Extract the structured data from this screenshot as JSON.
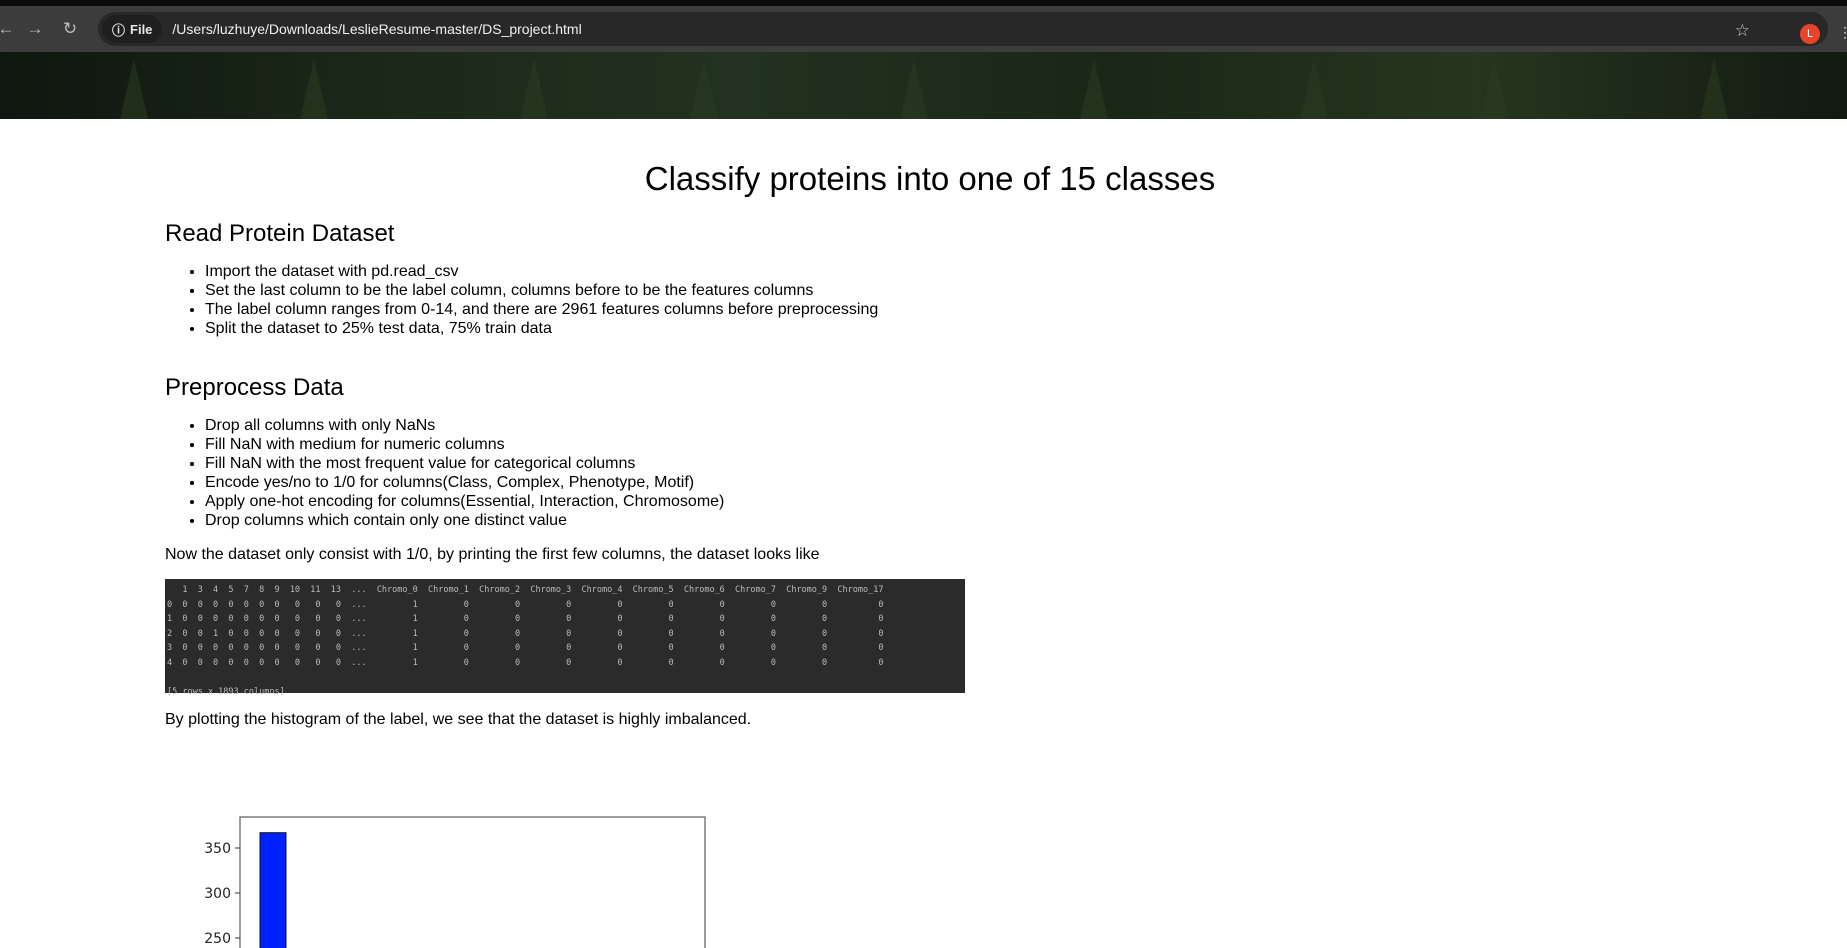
{
  "browser": {
    "chip_label": "File",
    "url": "/Users/luzhuye/Downloads/LeslieResume-master/DS_project.html",
    "avatar_letter": "L"
  },
  "page": {
    "title": "Classify proteins into one of 15 classes",
    "section1": {
      "heading": "Read Protein Dataset",
      "items": [
        "Import the dataset with pd.read_csv",
        "Set the last column to be the label column, columns before to be the features columns",
        "The label column ranges from 0-14, and there are 2961 features columns before preprocessing",
        "Split the dataset to 25% test data, 75% train data"
      ]
    },
    "section2": {
      "heading": "Preprocess Data",
      "items": [
        "Drop all columns with only NaNs",
        "Fill NaN with medium for numeric columns",
        "Fill NaN with the most frequent value for categorical columns",
        "Encode yes/no to 1/0 for columns(Class, Complex, Phenotype, Motif)",
        "Apply one-hot encoding for columns(Essential, Interaction, Chromosome)",
        "Drop columns which contain only one distinct value"
      ]
    },
    "para1": "Now the dataset only consist with 1/0, by printing the first few columns, the dataset looks like",
    "dataframe": {
      "header": "   1  3  4  5  7  8  9  10  11  13  ...  Chromo_0  Chromo_1  Chromo_2  Chromo_3  Chromo_4  Chromo_5  Chromo_6  Chromo_7  Chromo_9  Chromo_17",
      "rows": [
        "0  0  0  0  0  0  0  0   0   0   0  ...         1         0         0         0         0         0         0         0         0          0",
        "1  0  0  0  0  0  0  0   0   0   0  ...         1         0         0         0         0         0         0         0         0          0",
        "2  0  0  1  0  0  0  0   0   0   0  ...         1         0         0         0         0         0         0         0         0          0",
        "3  0  0  0  0  0  0  0   0   0   0  ...         1         0         0         0         0         0         0         0         0          0",
        "4  0  0  0  0  0  0  0   0   0   0  ...         1         0         0         0         0         0         0         0         0          0"
      ],
      "footer": "[5 rows x 1893 columns]"
    },
    "para2": "By plotting the histogram of the label, we see that the dataset is highly imbalanced."
  },
  "chart_data": {
    "type": "bar",
    "bar_color": "#0022ff",
    "values": [
      367
    ],
    "yticks": [
      250,
      300,
      350
    ],
    "ylim_visible": [
      240,
      380
    ]
  }
}
